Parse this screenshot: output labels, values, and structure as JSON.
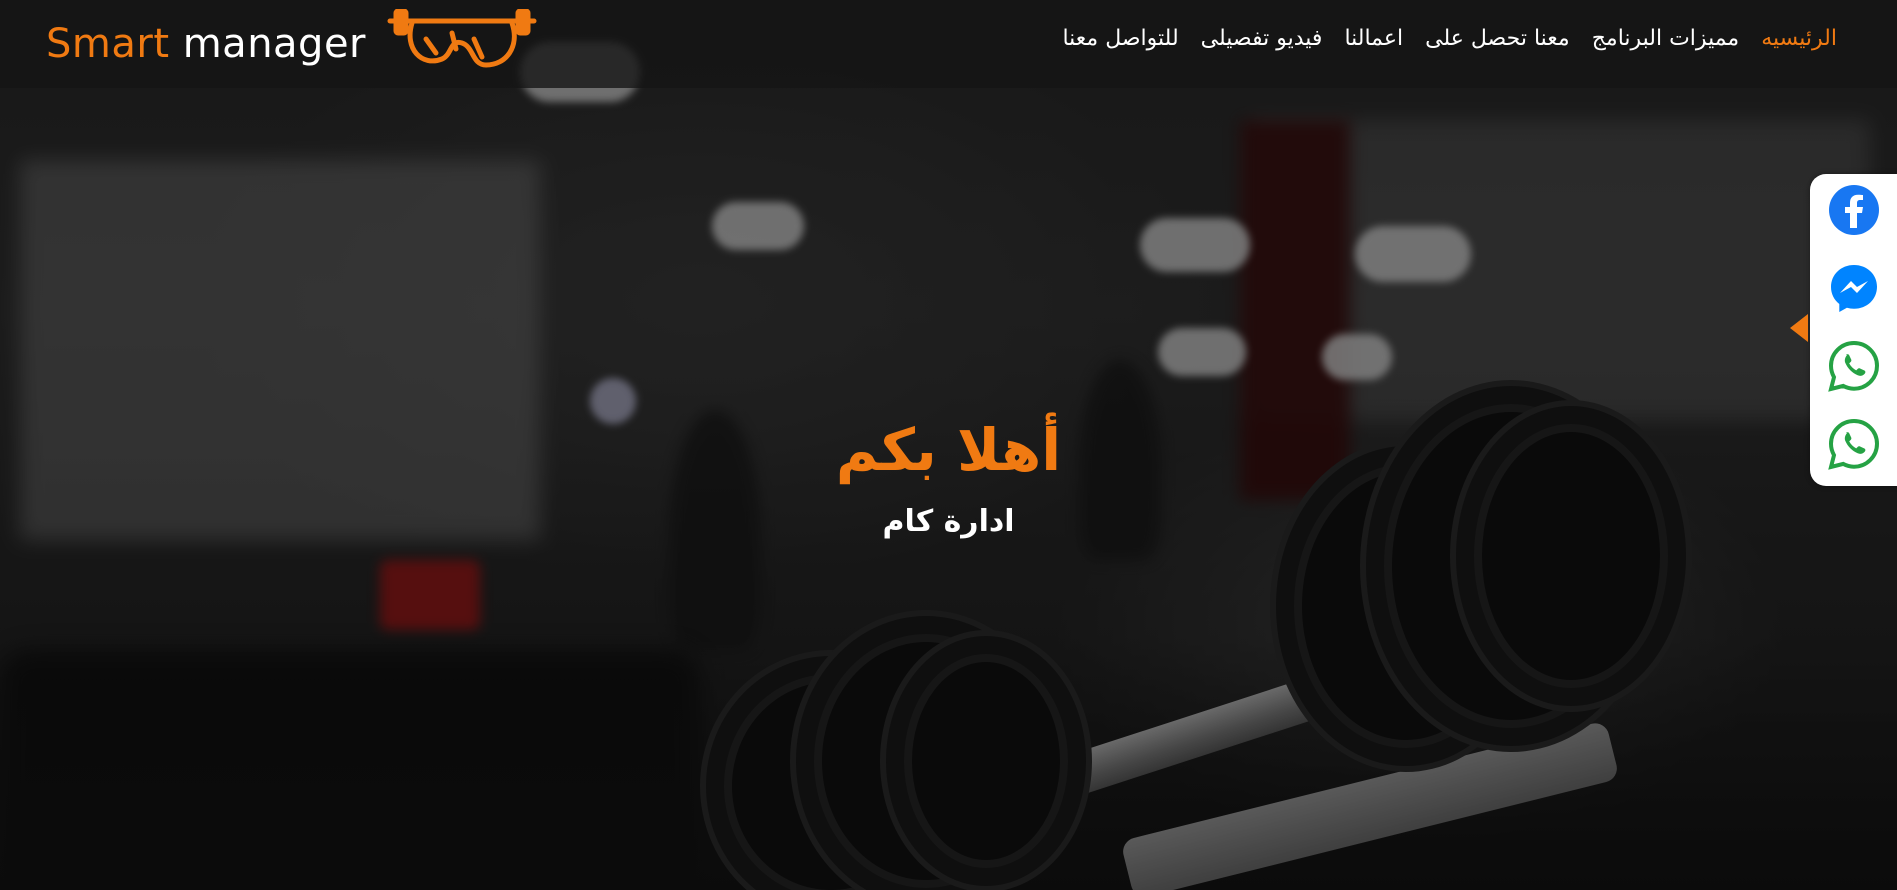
{
  "brand": {
    "smart": "Smart",
    "manager": " manager"
  },
  "nav": {
    "items": [
      {
        "label": "الرئيسيه",
        "active": true
      },
      {
        "label": "مميزات البرنامج",
        "active": false
      },
      {
        "label": "معنا تحصل على",
        "active": false
      },
      {
        "label": "اعمالنا",
        "active": false
      },
      {
        "label": "فيديو تفصيلى",
        "active": false
      },
      {
        "label": "للتواصل معنا",
        "active": false
      }
    ]
  },
  "hero": {
    "title": "أهلا بكم",
    "subtitle": "ادارة كام"
  },
  "social": {
    "buttons": [
      {
        "icon": "facebook-icon",
        "color": "#1877f2"
      },
      {
        "icon": "messenger-icon",
        "color": "#0084ff"
      },
      {
        "icon": "whatsapp-icon",
        "color": "#25a244"
      },
      {
        "icon": "whatsapp-icon",
        "color": "#25a244"
      }
    ]
  },
  "colors": {
    "accent": "#f07a12",
    "header_bg": "#141414"
  }
}
